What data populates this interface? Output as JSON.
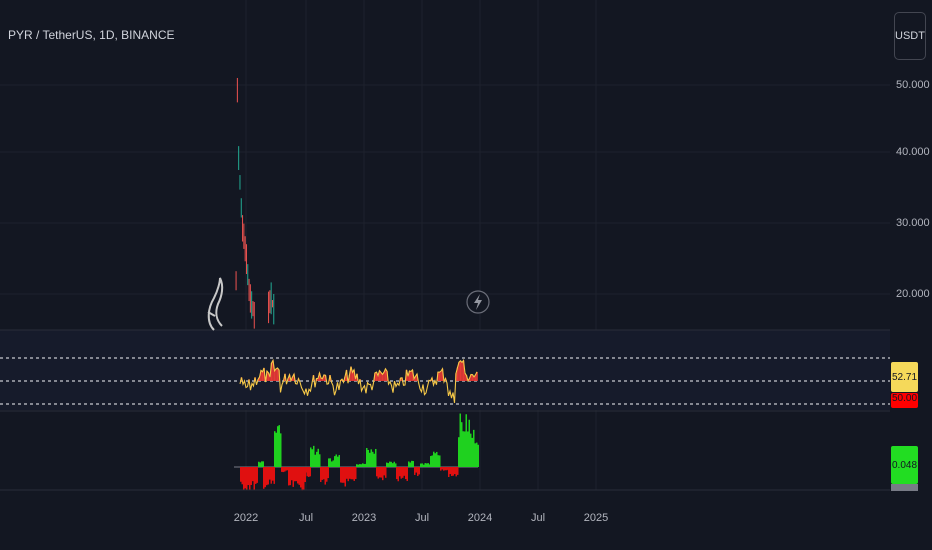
{
  "header": {
    "title": "PYR / TetherUS, 1D, BINANCE",
    "currency": "USDT"
  },
  "colors": {
    "background": "#131722",
    "grid": "#1e222d",
    "up": "#22ab94",
    "down": "#ef5350",
    "rsi_line": "#f7c948",
    "rsi_fill": "#e53935",
    "hist_up": "#1fd11f",
    "hist_down": "#e01010",
    "badge_rsi": "#f5d95a",
    "badge_red": "#ff0000",
    "badge_hist": "#22dd22"
  },
  "price_axis": {
    "ticks": [
      "50.000",
      "40.000",
      "30.000",
      "20.000"
    ]
  },
  "time_axis": {
    "ticks": [
      "2022",
      "Jul",
      "2023",
      "Jul",
      "2024",
      "Jul",
      "2025"
    ]
  },
  "badges": {
    "rsi_value": "52.71",
    "rsi_second": "50.00",
    "hist_value": "0.048"
  },
  "icons": {
    "alert": "lightning-icon",
    "crypto": "crypto-logo-icon"
  },
  "chart_data": [
    {
      "type": "line",
      "title": "PYR / TetherUS, 1D, BINANCE",
      "series_type": "candlestick",
      "ylim": [
        0,
        52
      ],
      "yticks": [
        50,
        40,
        30,
        20
      ],
      "x": [
        "2021-12-01",
        "2021-12-05",
        "2021-12-09",
        "2021-12-14",
        "2021-12-20",
        "2021-12-27",
        "2022-01-05",
        "2022-01-15",
        "2022-02-01",
        "2022-03-01",
        "2022-03-20",
        "2022-04-05",
        "2022-05-01"
      ],
      "series": [
        {
          "values": [
            22,
            50,
            40,
            35,
            30,
            27,
            24,
            19,
            16,
            14,
            20,
            15,
            13
          ]
        }
      ]
    },
    {
      "type": "line",
      "series_type": "rsi",
      "ylim": [
        20,
        80
      ],
      "levels": [
        70,
        50,
        30
      ],
      "current": 52.71
    },
    {
      "type": "bar",
      "series_type": "histogram",
      "current": 0.048
    }
  ]
}
